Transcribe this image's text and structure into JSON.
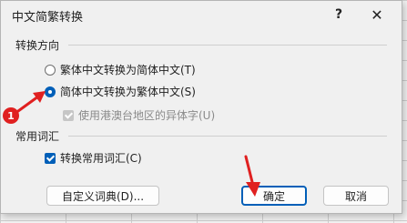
{
  "dialog": {
    "title": "中文简繁转换",
    "help_label": "?",
    "close_label": "✕"
  },
  "direction": {
    "label": "转换方向",
    "options": [
      {
        "label": "繁体中文转换为简体中文(T)",
        "selected": false
      },
      {
        "label": "简体中文转换为繁体中文(S)",
        "selected": true
      }
    ],
    "hk_variant_label": "使用港澳台地区的异体字(U)"
  },
  "common": {
    "label": "常用词汇",
    "convert_terms_label": "转换常用词汇(C)"
  },
  "buttons": {
    "custom_dict": "自定义词典(D)...",
    "ok": "确定",
    "cancel": "取消"
  },
  "annotation": {
    "badge_number": "1"
  },
  "colors": {
    "accent": "#005fb8",
    "annotation_red": "#e02020"
  }
}
